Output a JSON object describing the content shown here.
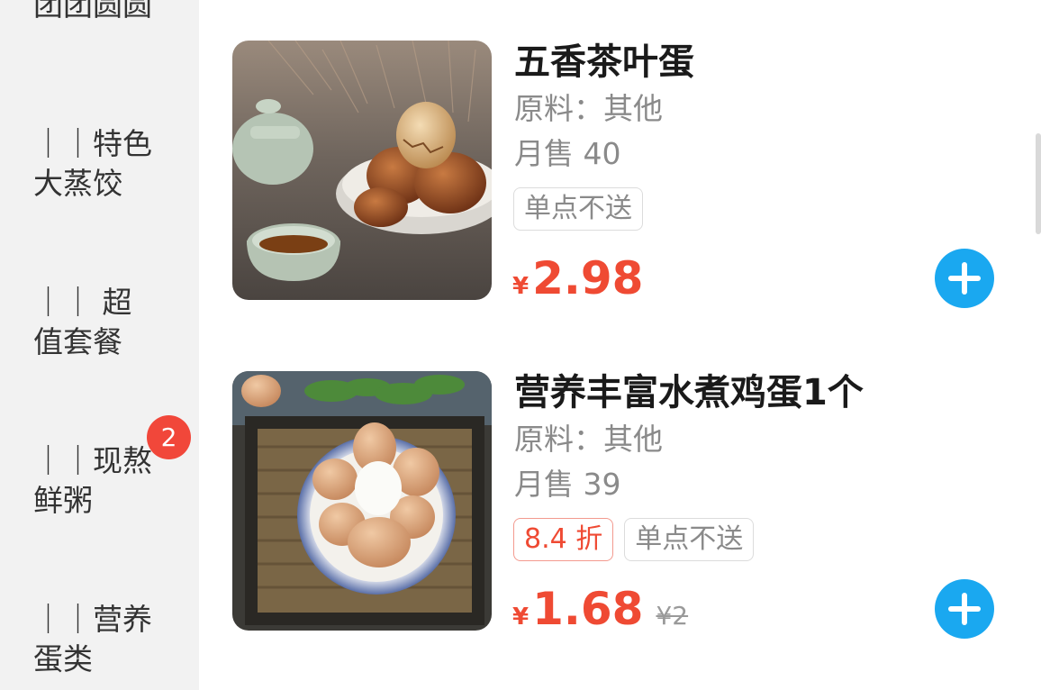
{
  "sidebar": {
    "categories": [
      {
        "line1": "团团圆圆",
        "line2": ""
      },
      {
        "line1": "｜｜特色",
        "line2": "大蒸饺"
      },
      {
        "line1": "｜｜ 超",
        "line2": "值套餐"
      },
      {
        "line1": "｜｜现熬",
        "line2": "鲜粥",
        "badge": "2"
      },
      {
        "line1": "｜｜营养",
        "line2": "蛋类"
      }
    ]
  },
  "products": [
    {
      "name": "五香茶叶蛋",
      "ingredients": "原料：其他",
      "sales": "月售 40",
      "tags": [
        "单点不送"
      ],
      "currency": "¥",
      "price": "2.98",
      "add_icon": "plus-icon"
    },
    {
      "name": "营养丰富水煮鸡蛋1个",
      "ingredients": "原料：其他",
      "sales": "月售 39",
      "discount": "8.4 折",
      "tags": [
        "单点不送"
      ],
      "currency": "¥",
      "price": "1.68",
      "original_price": "¥2",
      "add_icon": "plus-icon"
    }
  ],
  "colors": {
    "accent_red": "#ef4a33",
    "add_button_blue": "#1aa8f0",
    "sidebar_bg": "#f2f2f2",
    "badge_red": "#f1473a"
  }
}
